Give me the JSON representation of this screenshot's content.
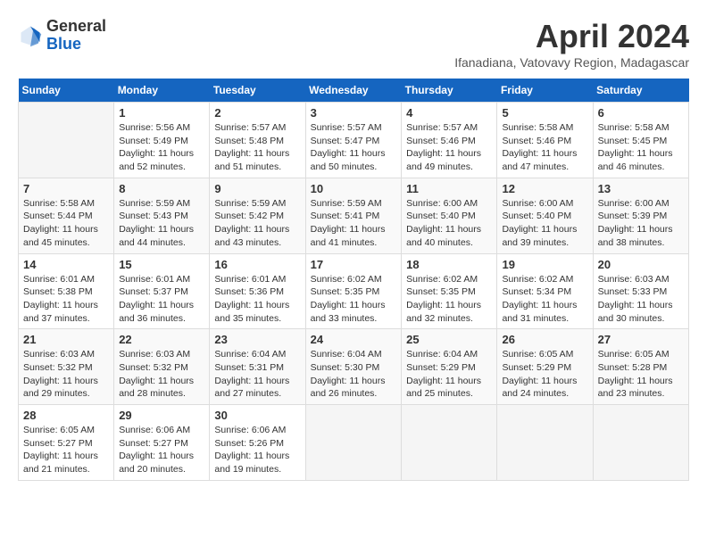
{
  "header": {
    "logo_general": "General",
    "logo_blue": "Blue",
    "month_title": "April 2024",
    "subtitle": "Ifanadiana, Vatovavy Region, Madagascar"
  },
  "weekdays": [
    "Sunday",
    "Monday",
    "Tuesday",
    "Wednesday",
    "Thursday",
    "Friday",
    "Saturday"
  ],
  "weeks": [
    [
      {
        "day": "",
        "info": ""
      },
      {
        "day": "1",
        "info": "Sunrise: 5:56 AM\nSunset: 5:49 PM\nDaylight: 11 hours\nand 52 minutes."
      },
      {
        "day": "2",
        "info": "Sunrise: 5:57 AM\nSunset: 5:48 PM\nDaylight: 11 hours\nand 51 minutes."
      },
      {
        "day": "3",
        "info": "Sunrise: 5:57 AM\nSunset: 5:47 PM\nDaylight: 11 hours\nand 50 minutes."
      },
      {
        "day": "4",
        "info": "Sunrise: 5:57 AM\nSunset: 5:46 PM\nDaylight: 11 hours\nand 49 minutes."
      },
      {
        "day": "5",
        "info": "Sunrise: 5:58 AM\nSunset: 5:46 PM\nDaylight: 11 hours\nand 47 minutes."
      },
      {
        "day": "6",
        "info": "Sunrise: 5:58 AM\nSunset: 5:45 PM\nDaylight: 11 hours\nand 46 minutes."
      }
    ],
    [
      {
        "day": "7",
        "info": "Sunrise: 5:58 AM\nSunset: 5:44 PM\nDaylight: 11 hours\nand 45 minutes."
      },
      {
        "day": "8",
        "info": "Sunrise: 5:59 AM\nSunset: 5:43 PM\nDaylight: 11 hours\nand 44 minutes."
      },
      {
        "day": "9",
        "info": "Sunrise: 5:59 AM\nSunset: 5:42 PM\nDaylight: 11 hours\nand 43 minutes."
      },
      {
        "day": "10",
        "info": "Sunrise: 5:59 AM\nSunset: 5:41 PM\nDaylight: 11 hours\nand 41 minutes."
      },
      {
        "day": "11",
        "info": "Sunrise: 6:00 AM\nSunset: 5:40 PM\nDaylight: 11 hours\nand 40 minutes."
      },
      {
        "day": "12",
        "info": "Sunrise: 6:00 AM\nSunset: 5:40 PM\nDaylight: 11 hours\nand 39 minutes."
      },
      {
        "day": "13",
        "info": "Sunrise: 6:00 AM\nSunset: 5:39 PM\nDaylight: 11 hours\nand 38 minutes."
      }
    ],
    [
      {
        "day": "14",
        "info": "Sunrise: 6:01 AM\nSunset: 5:38 PM\nDaylight: 11 hours\nand 37 minutes."
      },
      {
        "day": "15",
        "info": "Sunrise: 6:01 AM\nSunset: 5:37 PM\nDaylight: 11 hours\nand 36 minutes."
      },
      {
        "day": "16",
        "info": "Sunrise: 6:01 AM\nSunset: 5:36 PM\nDaylight: 11 hours\nand 35 minutes."
      },
      {
        "day": "17",
        "info": "Sunrise: 6:02 AM\nSunset: 5:35 PM\nDaylight: 11 hours\nand 33 minutes."
      },
      {
        "day": "18",
        "info": "Sunrise: 6:02 AM\nSunset: 5:35 PM\nDaylight: 11 hours\nand 32 minutes."
      },
      {
        "day": "19",
        "info": "Sunrise: 6:02 AM\nSunset: 5:34 PM\nDaylight: 11 hours\nand 31 minutes."
      },
      {
        "day": "20",
        "info": "Sunrise: 6:03 AM\nSunset: 5:33 PM\nDaylight: 11 hours\nand 30 minutes."
      }
    ],
    [
      {
        "day": "21",
        "info": "Sunrise: 6:03 AM\nSunset: 5:32 PM\nDaylight: 11 hours\nand 29 minutes."
      },
      {
        "day": "22",
        "info": "Sunrise: 6:03 AM\nSunset: 5:32 PM\nDaylight: 11 hours\nand 28 minutes."
      },
      {
        "day": "23",
        "info": "Sunrise: 6:04 AM\nSunset: 5:31 PM\nDaylight: 11 hours\nand 27 minutes."
      },
      {
        "day": "24",
        "info": "Sunrise: 6:04 AM\nSunset: 5:30 PM\nDaylight: 11 hours\nand 26 minutes."
      },
      {
        "day": "25",
        "info": "Sunrise: 6:04 AM\nSunset: 5:29 PM\nDaylight: 11 hours\nand 25 minutes."
      },
      {
        "day": "26",
        "info": "Sunrise: 6:05 AM\nSunset: 5:29 PM\nDaylight: 11 hours\nand 24 minutes."
      },
      {
        "day": "27",
        "info": "Sunrise: 6:05 AM\nSunset: 5:28 PM\nDaylight: 11 hours\nand 23 minutes."
      }
    ],
    [
      {
        "day": "28",
        "info": "Sunrise: 6:05 AM\nSunset: 5:27 PM\nDaylight: 11 hours\nand 21 minutes."
      },
      {
        "day": "29",
        "info": "Sunrise: 6:06 AM\nSunset: 5:27 PM\nDaylight: 11 hours\nand 20 minutes."
      },
      {
        "day": "30",
        "info": "Sunrise: 6:06 AM\nSunset: 5:26 PM\nDaylight: 11 hours\nand 19 minutes."
      },
      {
        "day": "",
        "info": ""
      },
      {
        "day": "",
        "info": ""
      },
      {
        "day": "",
        "info": ""
      },
      {
        "day": "",
        "info": ""
      }
    ]
  ]
}
